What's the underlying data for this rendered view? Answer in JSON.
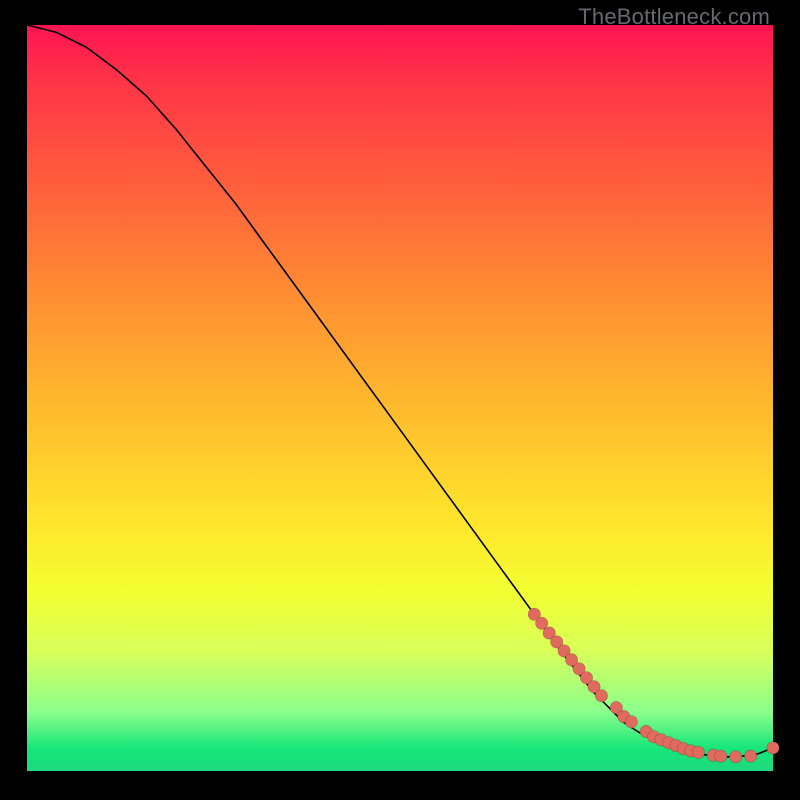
{
  "watermark": "TheBottleneck.com",
  "colors": {
    "dot": "#e06a5e",
    "curve": "#000000"
  },
  "chart_data": {
    "type": "line",
    "title": "",
    "xlabel": "",
    "ylabel": "",
    "xlim": [
      0,
      100
    ],
    "ylim": [
      0,
      100
    ],
    "grid": false,
    "legend": false,
    "series": [
      {
        "name": "bottleneck-curve",
        "x": [
          0,
          4,
          8,
          12,
          16,
          20,
          24,
          28,
          32,
          36,
          40,
          44,
          48,
          52,
          56,
          60,
          64,
          68,
          72,
          76,
          80,
          82,
          84,
          86,
          88,
          90,
          92,
          94,
          96,
          98,
          100
        ],
        "y": [
          100,
          99,
          97,
          94,
          90.5,
          86,
          81,
          76,
          70.5,
          65,
          59.5,
          54,
          48.5,
          43,
          37.5,
          32,
          26.5,
          21,
          15.5,
          10.5,
          6.5,
          5.2,
          4.2,
          3.4,
          2.7,
          2.3,
          2.0,
          1.9,
          2.0,
          2.3,
          3.1
        ]
      }
    ],
    "scatter": {
      "name": "highlighted-points",
      "x": [
        68,
        69,
        70,
        71,
        72,
        73,
        74,
        75,
        76,
        77,
        79,
        80,
        81,
        83,
        84,
        85,
        86,
        87,
        88,
        89,
        90,
        92,
        93,
        95,
        97,
        100
      ],
      "y": [
        21,
        19.8,
        18.5,
        17.3,
        16.1,
        14.9,
        13.7,
        12.5,
        11.3,
        10.1,
        8.5,
        7.3,
        6.6,
        5.3,
        4.6,
        4.2,
        3.8,
        3.4,
        3.0,
        2.7,
        2.5,
        2.1,
        2.0,
        1.9,
        2.0,
        3.1
      ]
    }
  }
}
